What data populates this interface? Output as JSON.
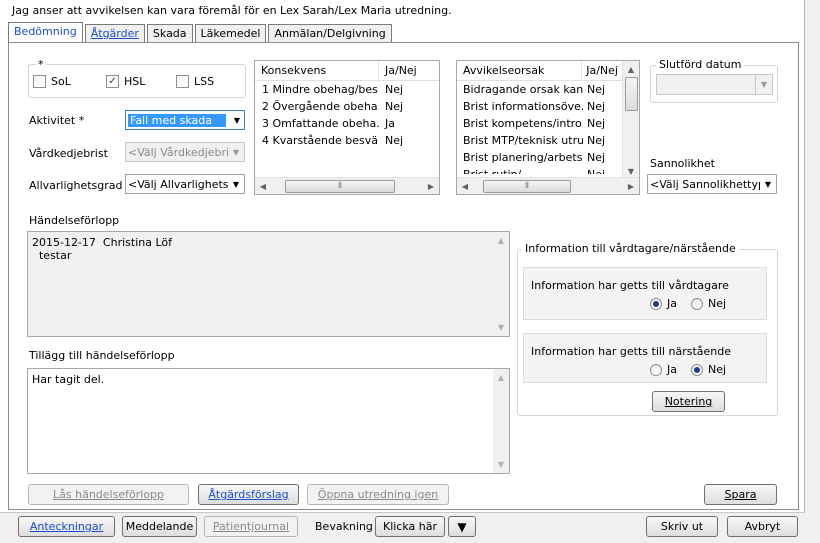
{
  "notice": "Jag anser att avvikelsen kan vara föremål för en Lex Sarah/Lex Maria utredning.",
  "tabs": [
    {
      "label": "Bedömning"
    },
    {
      "label": "Åtgärder"
    },
    {
      "label": "Skada"
    },
    {
      "label": "Läkemedel"
    },
    {
      "label": "Anmälan/Delgivning"
    }
  ],
  "required_star": "*",
  "checkboxes": {
    "sol": {
      "label": "SoL",
      "checked": false
    },
    "hsl": {
      "label": "HSL",
      "checked": true,
      "mark": "✓"
    },
    "lss": {
      "label": "LSS",
      "checked": false
    }
  },
  "fields": {
    "aktivitet": {
      "label": "Aktivitet *",
      "value": "Fall med skada"
    },
    "vardkedjebrist": {
      "label": "Vårdkedjebrist",
      "value": "<Välj Vårdkedjebrist>"
    },
    "allvarlighetsgrad": {
      "label": "Allvarlighetsgrad",
      "value": "<Välj Allvarlighetsgra"
    },
    "slutford_datum": {
      "label": "Slutförd datum",
      "value": ""
    },
    "sannolikhet": {
      "label": "Sannolikhet",
      "value": "<Välj Sannolikhettyp>"
    }
  },
  "konsekvens": {
    "headers": [
      "Konsekvens",
      "Ja/Nej"
    ],
    "rows": [
      [
        "1 Mindre obehag/bes...",
        "Nej"
      ],
      [
        "2 Övergående obeha...",
        "Nej"
      ],
      [
        "3 Omfattande obeha...",
        "Ja"
      ],
      [
        "4 Kvarstående besvä...",
        "Nej"
      ]
    ]
  },
  "avvikelseorsak": {
    "headers": [
      "Avvikelseorsak",
      "Ja/Nej"
    ],
    "rows": [
      [
        "Bidragande orsak kan...",
        "Nej"
      ],
      [
        "Brist informationsöve...",
        "Nej"
      ],
      [
        "Brist kompetens/intro...",
        "Nej"
      ],
      [
        "Brist MTP/teknisk utru...",
        "Nej"
      ],
      [
        "Brist planering/arbets...",
        "Nej"
      ],
      [
        "Brist rutin/...",
        "Nej"
      ]
    ]
  },
  "scroll_glyphs": {
    "left": "◀",
    "right": "▶",
    "up": "▲",
    "down": "▼",
    "grip": "⦀",
    "dropdown": "▼"
  },
  "handelseforlopp": {
    "label": "Händelseförlopp",
    "text": "2015-12-17  Christina Löf\n  testar"
  },
  "tillagg": {
    "label": "Tillägg till händelseförlopp",
    "text": "Har tagit del."
  },
  "information": {
    "title": "Information till vårdtagare/närstående",
    "vardtagare": {
      "label": "Information har getts till vårdtagare",
      "ja": "Ja",
      "nej": "Nej",
      "selected": "ja"
    },
    "narstaende": {
      "label": "Information har getts till närstående",
      "ja": "Ja",
      "nej": "Nej",
      "selected": "nej"
    },
    "notering_button": "Notering"
  },
  "buttons": {
    "las": "Lås händelseförlopp",
    "atgardsforslag": "Åtgärdsförslag",
    "oppna": "Öppna utredning igen",
    "spara": "Spara"
  },
  "bottom": {
    "anteckningar": "Anteckningar",
    "meddelande": "Meddelande",
    "patientjournal": "Patientjournal",
    "bevakning_label": "Bevakning",
    "klicka_har": "Klicka här",
    "skriv_ut": "Skriv ut",
    "avbryt": "Avbryt"
  }
}
